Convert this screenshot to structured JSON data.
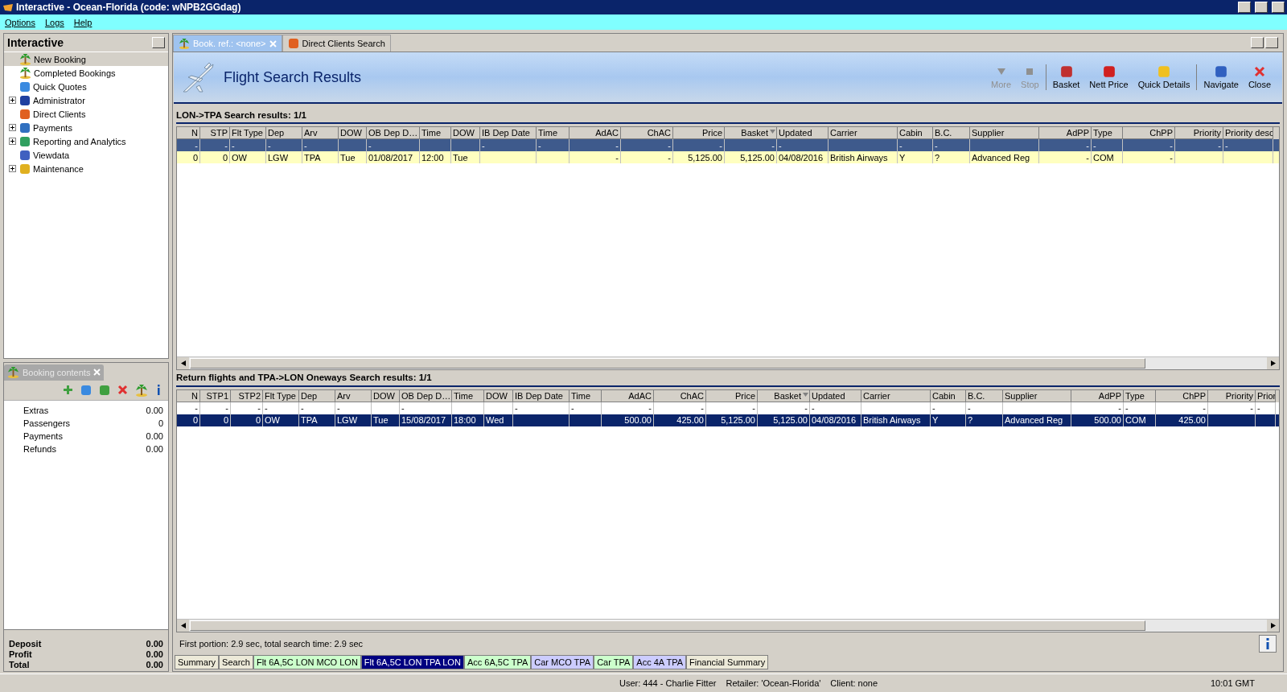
{
  "window": {
    "title": "Interactive - Ocean-Florida (code: wNPB2GGdag)"
  },
  "menu": [
    "Options",
    "Logs",
    "Help"
  ],
  "navigator": {
    "title": "Interactive",
    "items": [
      {
        "label": "New Booking",
        "kind": "leaf",
        "selected": true
      },
      {
        "label": "Completed Bookings",
        "kind": "leaf",
        "selected": false
      },
      {
        "label": "Quick Quotes",
        "kind": "leaf",
        "selected": false
      },
      {
        "label": "Administrator",
        "kind": "folder",
        "selected": false
      },
      {
        "label": "Direct Clients",
        "kind": "leaf",
        "selected": false
      },
      {
        "label": "Payments",
        "kind": "folder",
        "selected": false
      },
      {
        "label": "Reporting and Analytics",
        "kind": "folder",
        "selected": false
      },
      {
        "label": "Viewdata",
        "kind": "leaf",
        "selected": false
      },
      {
        "label": "Maintenance",
        "kind": "folder",
        "selected": false
      }
    ]
  },
  "booking_contents": {
    "title": "Booking contents",
    "rows": [
      {
        "label": "Extras",
        "value": "0.00"
      },
      {
        "label": "Passengers",
        "value": "0"
      },
      {
        "label": "Payments",
        "value": "0.00"
      },
      {
        "label": "Refunds",
        "value": "0.00"
      }
    ],
    "totals": [
      {
        "label": "Deposit",
        "value": "0.00"
      },
      {
        "label": "Profit",
        "value": "0.00"
      },
      {
        "label": "Total",
        "value": "0.00"
      }
    ]
  },
  "tabs": [
    {
      "label": "Book. ref.: <none>",
      "selected": true
    },
    {
      "label": "Direct Clients Search",
      "selected": false
    }
  ],
  "header": {
    "title": "Flight Search Results"
  },
  "toolbar": [
    {
      "label": "More",
      "disabled": true
    },
    {
      "label": "Stop",
      "disabled": true
    },
    {
      "label": "Basket",
      "disabled": false
    },
    {
      "label": "Nett Price",
      "disabled": false
    },
    {
      "label": "Quick Details",
      "disabled": false
    },
    {
      "label": "Navigate",
      "disabled": false
    },
    {
      "label": "Close",
      "disabled": false
    }
  ],
  "tables": [
    {
      "title": "LON->TPA Search results: 1/1",
      "focused": true,
      "columns": [
        {
          "label": "N",
          "kind": "number",
          "sorted": false,
          "filter": "-"
        },
        {
          "label": "STP",
          "kind": "number",
          "sorted": false,
          "filter": "-"
        },
        {
          "label": "Flt Type",
          "kind": "text",
          "sorted": false,
          "filter": "-"
        },
        {
          "label": "Dep",
          "kind": "text",
          "sorted": false,
          "filter": "-"
        },
        {
          "label": "Arv",
          "kind": "text",
          "sorted": false,
          "filter": "-"
        },
        {
          "label": "DOW",
          "kind": "text",
          "sorted": false
        },
        {
          "label": "OB Dep D…",
          "kind": "text",
          "sorted": false,
          "filter": "-"
        },
        {
          "label": "Time",
          "kind": "text",
          "sorted": false
        },
        {
          "label": "DOW",
          "kind": "text",
          "sorted": false
        },
        {
          "label": "IB Dep Date",
          "kind": "text",
          "sorted": false,
          "filter": "-"
        },
        {
          "label": "Time",
          "kind": "text",
          "sorted": false,
          "filter": "-"
        },
        {
          "label": "AdAC",
          "kind": "number",
          "sorted": false,
          "filter": "-"
        },
        {
          "label": "ChAC",
          "kind": "number",
          "sorted": false,
          "filter": "-"
        },
        {
          "label": "Price",
          "kind": "number",
          "sorted": false,
          "filter": "-"
        },
        {
          "label": "Basket",
          "kind": "number",
          "sorted": true,
          "filter": "-"
        },
        {
          "label": "Updated",
          "kind": "text",
          "sorted": false,
          "filter": "-"
        },
        {
          "label": "Carrier",
          "kind": "text",
          "sorted": false
        },
        {
          "label": "Cabin",
          "kind": "text",
          "sorted": false,
          "filter": "-"
        },
        {
          "label": "B.C.",
          "kind": "text",
          "sorted": false,
          "filter": "-"
        },
        {
          "label": "Supplier",
          "kind": "text",
          "sorted": false
        },
        {
          "label": "AdPP",
          "kind": "number",
          "sorted": false,
          "filter": "-"
        },
        {
          "label": "Type",
          "kind": "text",
          "sorted": false,
          "filter": "-"
        },
        {
          "label": "ChPP",
          "kind": "number",
          "sorted": false,
          "filter": "-"
        },
        {
          "label": "Priority",
          "kind": "number",
          "sorted": false,
          "filter": "-"
        },
        {
          "label": "Priority desc",
          "kind": "text",
          "sorted": false,
          "filter": "-"
        }
      ],
      "rows": [
        {
          "selected": false,
          "cells": [
            "0",
            "0",
            "OW",
            "LGW",
            "TPA",
            "Tue",
            "01/08/2017",
            "12:00",
            "Tue",
            null,
            null,
            "-",
            "-",
            "5,125.00",
            "5,125.00",
            "04/08/2016",
            "British Airways",
            "Y",
            "?",
            "Advanced Reg",
            "-",
            "COM",
            "-",
            null,
            null
          ]
        }
      ]
    },
    {
      "title": "Return flights and TPA->LON Oneways Search results: 1/1",
      "focused": false,
      "columns": [
        {
          "label": "N",
          "kind": "number",
          "sorted": false,
          "filter": "-"
        },
        {
          "label": "STP1",
          "kind": "number",
          "sorted": false,
          "filter": "-"
        },
        {
          "label": "STP2",
          "kind": "number",
          "sorted": false,
          "filter": "-"
        },
        {
          "label": "Flt Type",
          "kind": "text",
          "sorted": false,
          "filter": "-"
        },
        {
          "label": "Dep",
          "kind": "text",
          "sorted": false,
          "filter": "-"
        },
        {
          "label": "Arv",
          "kind": "text",
          "sorted": false,
          "filter": "-"
        },
        {
          "label": "DOW",
          "kind": "text",
          "sorted": false
        },
        {
          "label": "OB Dep D…",
          "kind": "text",
          "sorted": false,
          "filter": "-"
        },
        {
          "label": "Time",
          "kind": "text",
          "sorted": false
        },
        {
          "label": "DOW",
          "kind": "text",
          "sorted": false
        },
        {
          "label": "IB Dep Date",
          "kind": "text",
          "sorted": false,
          "filter": "-"
        },
        {
          "label": "Time",
          "kind": "text",
          "sorted": false,
          "filter": "-"
        },
        {
          "label": "AdAC",
          "kind": "number",
          "sorted": false,
          "filter": "-"
        },
        {
          "label": "ChAC",
          "kind": "number",
          "sorted": false,
          "filter": "-"
        },
        {
          "label": "Price",
          "kind": "number",
          "sorted": false,
          "filter": "-"
        },
        {
          "label": "Basket",
          "kind": "number",
          "sorted": true,
          "filter": "-"
        },
        {
          "label": "Updated",
          "kind": "text",
          "sorted": false,
          "filter": "-"
        },
        {
          "label": "Carrier",
          "kind": "text",
          "sorted": false
        },
        {
          "label": "Cabin",
          "kind": "text",
          "sorted": false,
          "filter": "-"
        },
        {
          "label": "B.C.",
          "kind": "text",
          "sorted": false,
          "filter": "-"
        },
        {
          "label": "Supplier",
          "kind": "text",
          "sorted": false
        },
        {
          "label": "AdPP",
          "kind": "number",
          "sorted": false,
          "filter": "-"
        },
        {
          "label": "Type",
          "kind": "text",
          "sorted": false,
          "filter": "-"
        },
        {
          "label": "ChPP",
          "kind": "number",
          "sorted": false,
          "filter": "-"
        },
        {
          "label": "Priority",
          "kind": "number",
          "sorted": false,
          "filter": "-"
        },
        {
          "label": "Prior",
          "kind": "text",
          "sorted": false,
          "filter": "-"
        }
      ],
      "rows": [
        {
          "selected": true,
          "cells": [
            "0",
            "0",
            "0",
            "OW",
            "TPA",
            "LGW",
            "Tue",
            "15/08/2017",
            "18:00",
            "Wed",
            null,
            null,
            "500.00",
            "425.00",
            "5,125.00",
            "5,125.00",
            "04/08/2016",
            "British Airways",
            "Y",
            "?",
            "Advanced Reg",
            "500.00",
            "COM",
            "425.00",
            null,
            null
          ]
        }
      ]
    }
  ],
  "timing": "First portion: 2.9 sec, total search time: 2.9 sec",
  "bottom_tabs": [
    {
      "label": "Summary",
      "selected": false,
      "color": "#ece9d8"
    },
    {
      "label": "Search",
      "selected": false,
      "color": "#ece9d8"
    },
    {
      "label": "Flt 6A,5C LON MCO LON",
      "selected": false,
      "color": "#ccffcc"
    },
    {
      "label": "Flt 6A,5C LON TPA LON",
      "selected": true,
      "color": "#000080"
    },
    {
      "label": "Acc 6A,5C TPA",
      "selected": false,
      "color": "#ccffcc"
    },
    {
      "label": "Car MCO TPA",
      "selected": false,
      "color": "#ccccff"
    },
    {
      "label": "Car TPA",
      "selected": false,
      "color": "#ccffcc"
    },
    {
      "label": "Acc 4A TPA",
      "selected": false,
      "color": "#ccccff"
    },
    {
      "label": "Financial Summary",
      "selected": false,
      "color": "#ece9d8"
    }
  ],
  "status_bar": {
    "user": "User: 444 - Charlie Fitter",
    "retailer": "Retailer: 'Ocean-Florida'",
    "client": "Client: none",
    "time": "10:01 GMT"
  }
}
